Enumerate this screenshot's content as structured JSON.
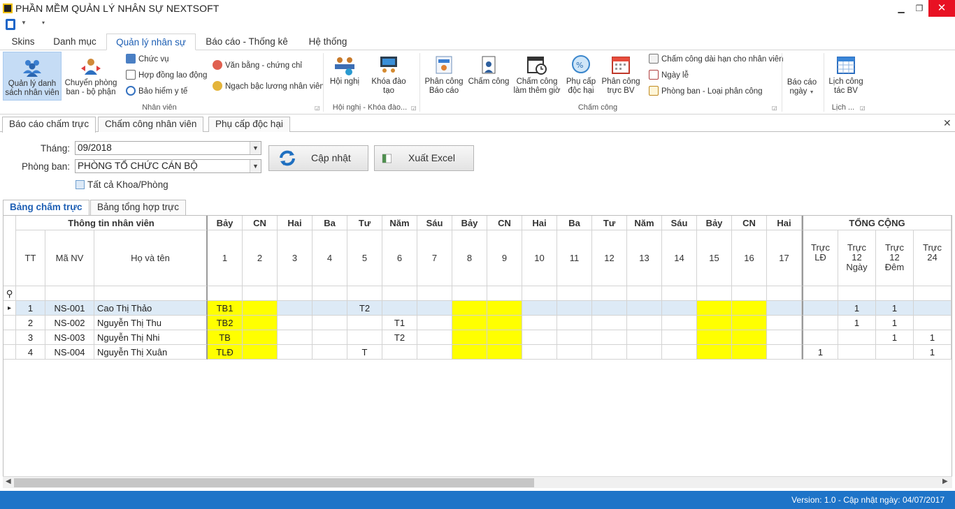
{
  "window": {
    "title": "PHẦN MỀM QUẢN LÝ NHÂN SỰ NEXTSOFT"
  },
  "ribbon_tabs": [
    "Skins",
    "Danh mục",
    "Quản lý nhân sự",
    "Báo cáo - Thống kê",
    "Hệ thống"
  ],
  "ribbon": {
    "nhan_vien": {
      "quan_ly": "Quản lý danh sách nhân viên",
      "chuyen_phong": "Chuyển phòng ban - bộ phận",
      "chuc_vu": "Chức vụ",
      "hop_dong": "Hợp đồng lao động",
      "bao_hiem": "Bảo hiểm y tế",
      "van_bang": "Văn bằng - chứng chỉ",
      "ngach_bac": "Ngạch bậc lương nhân viên",
      "label": "Nhân viên"
    },
    "hoi_nghi": {
      "hoi_nghi": "Hội nghị",
      "khoa_dao_tao": "Khóa đào tạo",
      "label": "Hội nghị - Khóa đào..."
    },
    "cham_cong": {
      "phan_cong_bc": "Phân công Báo cáo",
      "cham_cong": "Chấm công",
      "lam_them": "Chấm công làm thêm giờ",
      "phu_cap": "Phụ cấp độc hại",
      "truc_bv": "Phân công trực BV",
      "dai_han": "Chấm công dài hạn cho nhân viên",
      "ngay_le": "Ngày lễ",
      "loai_pc": "Phòng ban - Loại phân công",
      "label": "Chấm công"
    },
    "bao_cao_ngay": "Báo cáo ngày",
    "lich": {
      "lich_cong_tac": "Lịch công tác BV",
      "label": "Lịch ..."
    }
  },
  "doc_tabs": [
    "Báo cáo chấm trực",
    "Chấm công nhân viên",
    "Phụ cấp độc hại"
  ],
  "filters": {
    "thang_label": "Tháng:",
    "thang_value": "09/2018",
    "phong_ban_label": "Phòng ban:",
    "phong_ban_value": "PHÒNG TỔ CHỨC CÁN BỘ",
    "tat_ca_label": "Tất cả Khoa/Phòng",
    "cap_nhat": "Cập nhật",
    "xuat_excel": "Xuất Excel"
  },
  "sub_tabs": [
    "Bảng chấm trực",
    "Bảng tổng hợp trực"
  ],
  "grid": {
    "group_info": "Thông tin nhân viên",
    "group_total": "TỔNG CỘNG",
    "col_tt": "TT",
    "col_manv": "Mã NV",
    "col_hoten": "Họ và tên",
    "weekdays": [
      "Bảy",
      "CN",
      "Hai",
      "Ba",
      "Tư",
      "Năm",
      "Sáu",
      "Bảy",
      "CN",
      "Hai",
      "Ba",
      "Tư",
      "Năm",
      "Sáu",
      "Bảy",
      "CN",
      "Hai"
    ],
    "days": [
      "1",
      "2",
      "3",
      "4",
      "5",
      "6",
      "7",
      "8",
      "9",
      "10",
      "11",
      "12",
      "13",
      "14",
      "15",
      "16",
      "17"
    ],
    "totals": [
      "Trực LĐ",
      "Trực 12 Ngày",
      "Trực 12 Đêm",
      "Trực 24"
    ],
    "rows": [
      {
        "tt": "1",
        "manv": "NS-001",
        "hoten": "Cao Thị Thảo",
        "d": [
          "TB1",
          "",
          "",
          "",
          "T2",
          "",
          "",
          "",
          "",
          "",
          "",
          "",
          "",
          "",
          "",
          "",
          ""
        ],
        "t": [
          "",
          "1",
          "1",
          ""
        ]
      },
      {
        "tt": "2",
        "manv": "NS-002",
        "hoten": "Nguyễn Thị Thu",
        "d": [
          "TB2",
          "",
          "",
          "",
          "",
          "T1",
          "",
          "",
          "",
          "",
          "",
          "",
          "",
          "",
          "",
          "",
          ""
        ],
        "t": [
          "",
          "1",
          "1",
          ""
        ]
      },
      {
        "tt": "3",
        "manv": "NS-003",
        "hoten": "Nguyễn Thị Nhi",
        "d": [
          "TB",
          "",
          "",
          "",
          "",
          "T2",
          "",
          "",
          "",
          "",
          "",
          "",
          "",
          "",
          "",
          "",
          ""
        ],
        "t": [
          "",
          "",
          "1",
          "1"
        ]
      },
      {
        "tt": "4",
        "manv": "NS-004",
        "hoten": "Nguyễn Thị Xuân",
        "d": [
          "TLĐ",
          "",
          "",
          "",
          "T",
          "",
          "",
          "",
          "",
          "",
          "",
          "",
          "",
          "",
          "",
          "",
          ""
        ],
        "t": [
          "1",
          "",
          "",
          "1"
        ]
      }
    ]
  },
  "status": {
    "text": "Version: 1.0 - Cập nhật ngày: 04/07/2017"
  },
  "colors": {
    "accent": "#1e74c8",
    "weekend": "#ffff00",
    "selected_row": "#ddeaf6"
  }
}
